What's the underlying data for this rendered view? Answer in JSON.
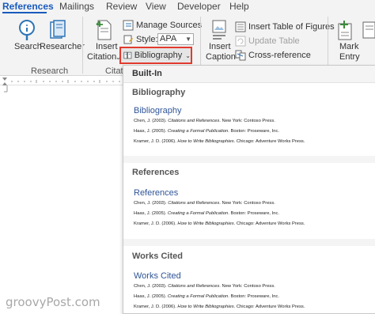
{
  "tabs": [
    {
      "label": "References",
      "active": true
    },
    {
      "label": "Mailings"
    },
    {
      "label": "Review"
    },
    {
      "label": "View"
    },
    {
      "label": "Developer"
    },
    {
      "label": "Help"
    }
  ],
  "ribbon": {
    "research": {
      "search_label": "Search",
      "researcher_label": "Researcher",
      "group_label": "Research"
    },
    "citations": {
      "insert_citation_line1": "Insert",
      "insert_citation_line2": "Citation",
      "manage_sources_label": "Manage Sources",
      "style_label": "Style:",
      "style_value": "APA",
      "bibliography_label": "Bibliography",
      "group_label_partial": "Citatio"
    },
    "captions": {
      "insert_caption_line1": "Insert",
      "insert_caption_line2": "Caption",
      "insert_table_of_figures_label": "Insert Table of Figures",
      "update_table_label": "Update Table",
      "cross_reference_label": "Cross-reference"
    },
    "index": {
      "mark_entry_line1": "Mark",
      "mark_entry_line2": "Entry"
    }
  },
  "dropdown": {
    "header": "Built-In",
    "sections": [
      {
        "title": "Bibliography",
        "heading": "Bibliography",
        "citations": [
          [
            "Chen, J. (2003). ",
            "Citations and References",
            ". New York: Contoso Press."
          ],
          [
            "Haas, J. (2005). ",
            "Creating a Formal Publication",
            ". Boston: Proseware, Inc."
          ],
          [
            "Kramer, J. D. (2006). ",
            "How to Write Bibliographies",
            ". Chicago: Adventure Works Press."
          ]
        ]
      },
      {
        "title": "References",
        "heading": "References",
        "citations": [
          [
            "Chen, J. (2003). ",
            "Citations and References",
            ". New York: Contoso Press."
          ],
          [
            "Haas, J. (2005). ",
            "Creating a Formal Publication",
            ". Boston: Proseware, Inc."
          ],
          [
            "Kramer, J. D. (2006). ",
            "How to Write Bibliographies",
            ". Chicago: Adventure Works Press."
          ]
        ]
      },
      {
        "title": "Works Cited",
        "heading": "Works Cited",
        "citations": [
          [
            "Chen, J. (2003). ",
            "Citations and References",
            ". New York: Contoso Press."
          ],
          [
            "Haas, J. (2005). ",
            "Creating a Formal Publication",
            ". Boston: Proseware, Inc."
          ],
          [
            "Kramer, J. D. (2006). ",
            "How to Write Bibliographies",
            ". Chicago: Adventure Works Press."
          ]
        ]
      }
    ]
  },
  "watermark": "groovyPost.com",
  "colors": {
    "accent": "#185abd",
    "highlight_border": "#e23a2e",
    "heading_blue": "#2f5597"
  }
}
